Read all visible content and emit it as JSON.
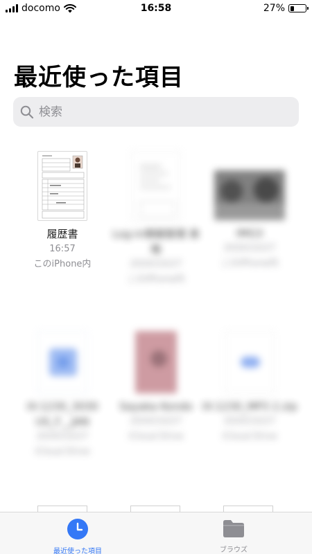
{
  "status_bar": {
    "carrier": "docomo",
    "time": "16:58",
    "battery_percent": "27%",
    "battery_level": 0.27,
    "signal_icon": "signal-bars-icon",
    "wifi_icon": "wifi-icon"
  },
  "page_title": "最近使った項目",
  "search": {
    "placeholder": "検索",
    "icon": "search-icon"
  },
  "files": [
    {
      "name": "履歴書",
      "time": "16:57",
      "location": "このiPhone内",
      "blurred": false
    },
    {
      "name": "Log-in情報管理 表格",
      "time": "2020/10/27",
      "location": "このiPhone内",
      "blurred": true
    },
    {
      "name": "IMG3",
      "time": "2020/10/27",
      "location": "このiPhone内",
      "blurred": true
    },
    {
      "name": "IX-1230_3030 US_F__JAN",
      "time": "2020/10/27",
      "location": "iCloud Drive",
      "blurred": true
    },
    {
      "name": "Sayaka Kondo",
      "time": "2020/10/27",
      "location": "iCloud Drive",
      "blurred": true
    },
    {
      "name": "IX-1230_MP3 2.zip",
      "time": "2020/10/27",
      "location": "iCloud Drive",
      "blurred": true
    }
  ],
  "tabs": [
    {
      "label": "最近使った項目",
      "icon": "clock-icon",
      "active": true
    },
    {
      "label": "ブラウズ",
      "icon": "folder-icon",
      "active": false
    }
  ],
  "colors": {
    "accent": "#3478f6",
    "inactive": "#8e8e93"
  }
}
